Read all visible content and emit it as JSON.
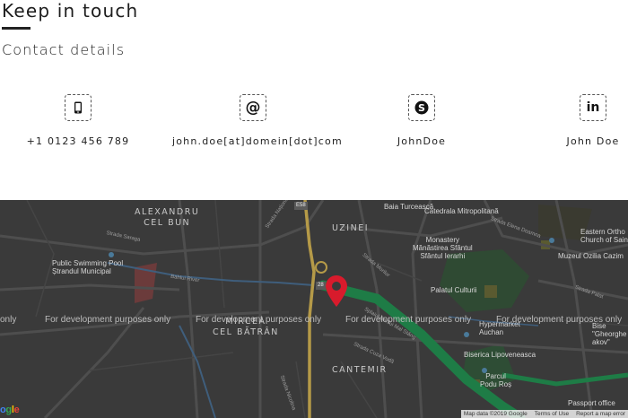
{
  "section": {
    "title": "Keep in touch",
    "subtitle": "Contact details"
  },
  "contacts": [
    {
      "icon": "phone-icon",
      "text": "+1 0123 456 789"
    },
    {
      "icon": "at-icon",
      "text": "john.doe[at]domein[dot]com"
    },
    {
      "icon": "skype-icon",
      "text": "JohnDoe"
    },
    {
      "icon": "linkedin-icon",
      "text": "John Doe"
    }
  ],
  "map": {
    "watermark": "For development purposes only",
    "watermark_left_fragment": "only",
    "districts": {
      "alexandru": "ALEXANDRU\nCEL BUN",
      "uzinei": "UZINEI",
      "mircea": "MIRCEA\nCEL BĂTRÂN",
      "cantemir": "CANTEMIR"
    },
    "places": {
      "pool": "Public Swimming Pool\nȘtrandul Municipal",
      "baia": "Baia Turcească",
      "catedrala": "Catedrala Mitropolitană",
      "monastery": "Monastery\nMănăstirea Sfântul\nSfântul Ierarhi",
      "eastern": "Eastern Ortho\nChurch of Sain",
      "muzeul": "Muzeul Ozilia Cazim",
      "palatul": "Palatul Culturii",
      "hypermarket": "Hypermarket\nAuchan",
      "gheorghe": "Bise\n\"Gheorghe\nakov\"",
      "biserica": "Biserica Lipoveneasca",
      "parcul": "Parcul\nPodu Roș",
      "passport": "Passport office"
    },
    "streets": {
      "saraga": "Strada Saraga",
      "bahlui": "Bahlui River",
      "splaiul": "Splaiul Bahlui Mal Stâng",
      "nicolina": "Strada Nicolina",
      "nationala": "Strada Națională",
      "elena": "Strada Elena Doamna",
      "morilor": "Strada Morilor",
      "palat": "Strada Palat",
      "cuza": "Strada Cuza Vodă"
    },
    "road_badges": {
      "e58": "E58",
      "dn28": "28"
    },
    "google": "Google",
    "footer": {
      "data": "Map data ©2019 Google",
      "terms": "Terms of Use",
      "report": "Report a map error"
    },
    "colors": {
      "accent_green": "#1e7c46",
      "marker_red": "#d81b2c",
      "road_yellow": "#b59a48"
    }
  }
}
